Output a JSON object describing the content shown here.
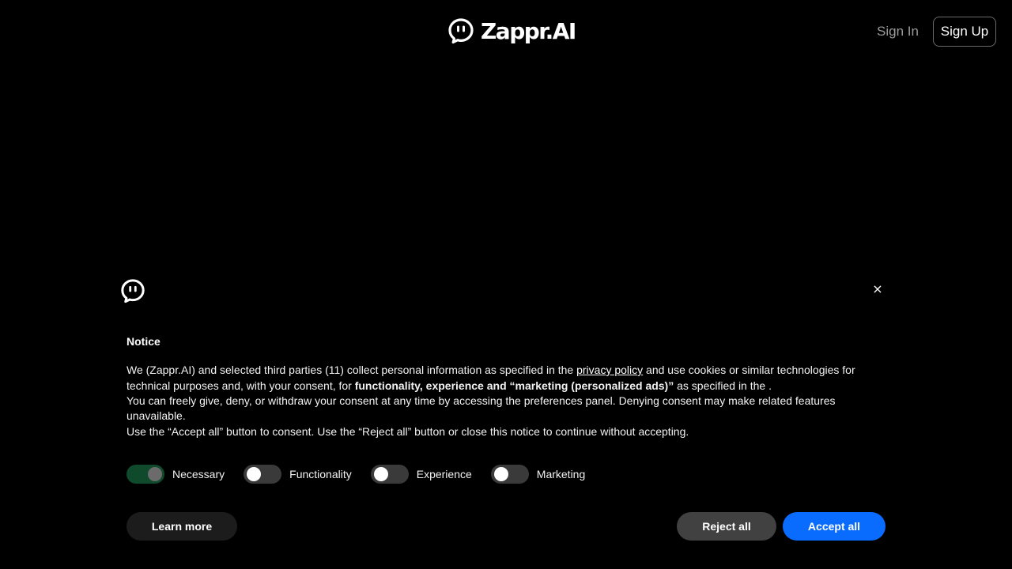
{
  "header": {
    "brand_name": "Zappr.AI",
    "brand_icon": "chat-bubble-face-icon",
    "signin_label": "Sign In",
    "signup_label": "Sign Up"
  },
  "consent": {
    "logo_icon": "chat-bubble-face-icon",
    "close_label": "×",
    "title": "Notice",
    "p1_a": "We (Zappr.AI) and selected third parties (11) collect personal information as specified in the ",
    "p1_link": "privacy policy",
    "p1_b": " and use cookies or similar technologies for technical purposes and, with your consent, for ",
    "p1_bold": "functionality, experience and “marketing (personalized ads)”",
    "p1_c": " as specified in the .",
    "p2": "You can freely give, deny, or withdraw your consent at any time by accessing the preferences panel. Denying consent may make related features unavailable.",
    "p3": "Use the “Accept all” button to consent. Use the “Reject all” button or close this notice to continue without accepting.",
    "toggles": [
      {
        "label": "Necessary",
        "on": true
      },
      {
        "label": "Functionality",
        "on": false
      },
      {
        "label": "Experience",
        "on": false
      },
      {
        "label": "Marketing",
        "on": false
      }
    ],
    "learn_more_label": "Learn more",
    "reject_label": "Reject all",
    "accept_label": "Accept all"
  },
  "colors": {
    "background": "#000000",
    "accept_button": "#0a6cff",
    "reject_button": "#414141",
    "toggle_on": "#0f4a2d"
  }
}
